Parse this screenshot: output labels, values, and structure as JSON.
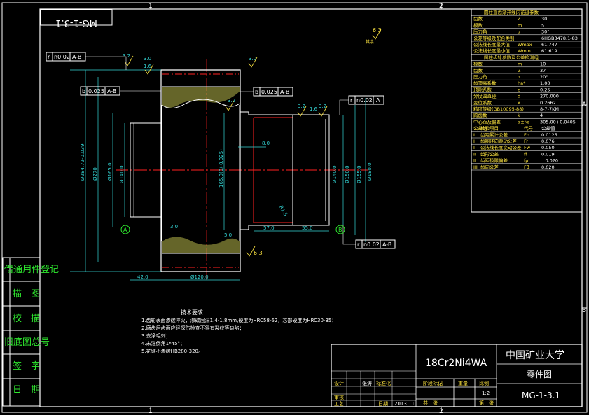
{
  "drawing_number_stamp": "MG-1-3.1",
  "zone_labels": {
    "top": [
      "1",
      "2"
    ],
    "right": [
      "A",
      "B"
    ]
  },
  "left_panel": [
    "借通用件登记",
    "描　图",
    "校　描",
    "旧底图总号",
    "签　字",
    "日　期"
  ],
  "gear_table": {
    "title": "圆柱直齿渐开线内花键参数",
    "rows": [
      [
        "齿数",
        "Z",
        "30"
      ],
      [
        "模数",
        "m",
        "5"
      ],
      [
        "压力角",
        "α",
        "30°"
      ],
      [
        "公差等级及配合类别",
        "",
        "6HGB3478.1-83"
      ],
      [
        "公法线长度最大值",
        "Wmax",
        "61.747"
      ],
      [
        "公法线长度最小值",
        "Wmin",
        "61.619"
      ]
    ],
    "title2": "圆柱齿轮参数及公差检测组",
    "rows2": [
      [
        "模数",
        "m",
        "10"
      ],
      [
        "齿数",
        "Z",
        "37"
      ],
      [
        "压力角",
        "α",
        "20°"
      ],
      [
        "齿顶高系数",
        "ha*",
        "1.00"
      ],
      [
        "顶隙系数",
        "c",
        "0.25"
      ],
      [
        "分度圆直径",
        "d",
        "270.000"
      ],
      [
        "变位系数",
        "x",
        "0.2662"
      ],
      [
        "精度等级(GB10095-88)",
        "",
        "8-7-7KM"
      ],
      [
        "跨齿数",
        "k",
        "4"
      ],
      [
        "中心距及偏差",
        "α±fα",
        "305.00+0.0405"
      ],
      [
        "公差组",
        "检验项目",
        "代号",
        "公差值"
      ],
      [
        "I",
        "齿距累计公差",
        "Fp",
        "0.0125"
      ],
      [
        "I",
        "齿圈径向跳动公差",
        "Fr",
        "0.076"
      ],
      [
        "I",
        "公法线长度变动公差",
        "Fw",
        "0.050"
      ],
      [
        "II",
        "齿形公差",
        "ff",
        "0.019"
      ],
      [
        "II",
        "齿距极限偏差",
        "fpt",
        "±0.020"
      ],
      [
        "III",
        "齿向公差",
        "Fβ",
        "0.020"
      ]
    ]
  },
  "tech_requirements": {
    "title": "技术要求",
    "items": [
      "1.齿轮表面渗碳淬火，渗碳层深1.4-1.8mm,硬度为HRC58-62，芯部硬度为HRC30-35；",
      "2.磨齿后齿面应经探伤检查不得有裂纹等缺陷；",
      "3.去净毛刺；",
      "4.未注倒角1*45°；",
      "5.花键不渗碳HB280-320。"
    ]
  },
  "title_block": {
    "material": "18Cr2Ni4WA",
    "school": "中国矿业大学",
    "part_name": "零件图",
    "drawing_no": "MG-1-3.1",
    "scale_label": "比例",
    "scale": "1:2",
    "weight_label": "重量",
    "mark_label": "阶段标记",
    "designer_label": "设计",
    "designer": "张涛",
    "std_label": "标准化",
    "review_label": "审核",
    "process_label": "工艺",
    "date_label": "日期",
    "date": "2013.11",
    "sheets_label": "共　张",
    "sheet_label": "第　张"
  },
  "annotations": {
    "roughness_general": "6.3",
    "roughness_note": "其余",
    "dims": [
      "Ø284.72-0.039",
      "Ø270",
      "Ø165.0",
      "Ø140.0",
      "165.0(0/-0.025)",
      "Ø140.0",
      "Ø150.0",
      "Ø155.0",
      "Ø180.0",
      "42.0",
      "Ø120.0",
      "57.0",
      "55.0",
      "3.0",
      "5.0",
      "8.0",
      "3.2",
      "1.6",
      "R1.5"
    ],
    "tolerance_frames": [
      [
        "r",
        "n0.02",
        "A-B"
      ],
      [
        "b",
        "0.025",
        "A-B"
      ],
      [
        "b",
        "0.025",
        "A-B"
      ],
      [
        "r",
        "n0.02",
        "A"
      ],
      [
        "r",
        "n0.02",
        "A-B"
      ]
    ],
    "datums": [
      "A",
      "B"
    ]
  }
}
